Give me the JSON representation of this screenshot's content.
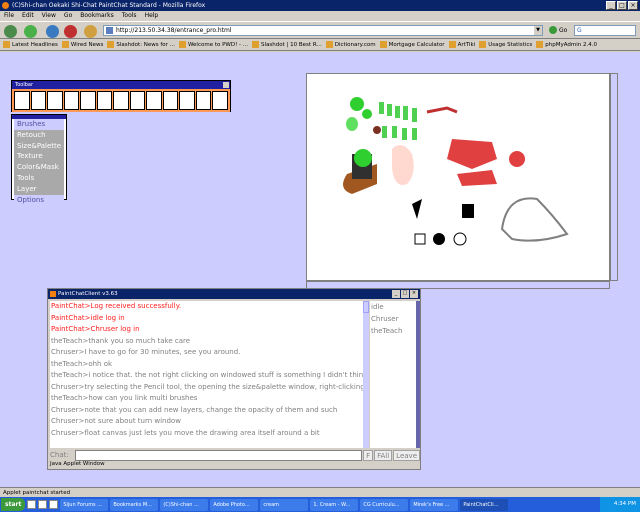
{
  "window": {
    "title": "(C)Shi-chan Oekaki Shi-Chat PaintChat Standard - Mozilla Firefox"
  },
  "menu": [
    "File",
    "Edit",
    "View",
    "Go",
    "Bookmarks",
    "Tools",
    "Help"
  ],
  "nav": {
    "url": "http://213.50.34.38/entrance_pro.html",
    "go": "Go"
  },
  "bookmarks": [
    "Latest Headlines",
    "Wired News",
    "Slashdot: News for ...",
    "Welcome to PWD! - ...",
    "Slashdot | 10 Best R...",
    "Dictionary.com",
    "Mortgage Calculator",
    "ArtTiki",
    "Usage Statistics",
    "phpMyAdmin 2.4.0"
  ],
  "palette": {
    "title": "Toolbar"
  },
  "menu_panel": {
    "items": [
      "Brushes",
      "Retouch",
      "Size&Palette",
      "Texture",
      "Color&Mask",
      "Tools",
      "Layer",
      "Options"
    ]
  },
  "chat": {
    "title": "PaintChatClient v3.63",
    "lines": [
      {
        "text": "PaintChat>Log received successfully.",
        "color": "red"
      },
      {
        "text": "PaintChat>idle log in",
        "color": "red"
      },
      {
        "text": "PaintChat>Chruser log in",
        "color": "red"
      },
      {
        "text": "theTeach>thank you so much take care",
        "color": "gray"
      },
      {
        "text": "Chruser>I have to go for 30 minutes, see you around.",
        "color": "gray"
      },
      {
        "text": "theTeach>ohh ok",
        "color": "gray"
      },
      {
        "text": "theTeach>i notice that. the not right clicking on windowed stuff is something I didn't think abo",
        "color": "gray"
      },
      {
        "text": "Chruser>try selecting the Pencil tool, the opening the size&palette window, right-clicking the",
        "color": "gray"
      },
      {
        "text": "theTeach>how can you link multi brushes",
        "color": "gray"
      },
      {
        "text": "Chruser>note that you can add new layers, change the opacity of them and such",
        "color": "gray"
      },
      {
        "text": "Chruser>not sure about turn window",
        "color": "gray"
      },
      {
        "text": "Chruser>float canvas just lets you move the drawing area itself around a bit",
        "color": "gray"
      }
    ],
    "users": [
      "idle",
      "Chruser",
      "theTeach"
    ],
    "chat_label": "Chat:",
    "buttons": [
      "F",
      "FAll",
      "Leave"
    ],
    "applet_status": "Java Applet Window"
  },
  "status": {
    "text": "Applet paintchat started"
  },
  "taskbar": {
    "start": "start",
    "tasks": [
      "Sijun Forums ...",
      "Bookmarks M...",
      "(C)Shi-chan ...",
      "Adobe Photo...",
      "cream",
      "1. Cream - W...",
      "CG Curriculu...",
      "Mirek's Free ...",
      "PaintChatCli..."
    ],
    "clock": "4:34 PM"
  }
}
